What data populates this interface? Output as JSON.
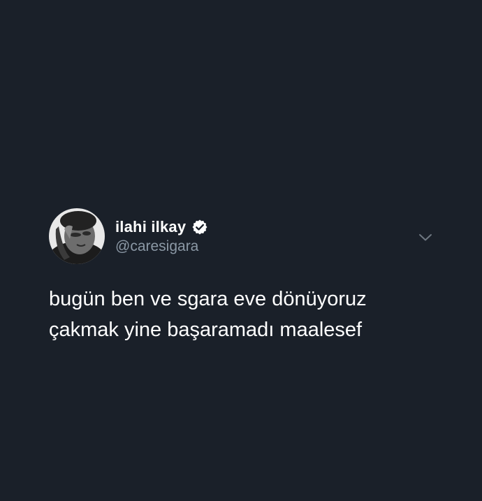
{
  "tweet": {
    "author": {
      "display_name": "ilahi ilkay",
      "handle": "@caresigara",
      "verified": true,
      "avatar_icon": "profile-photo"
    },
    "text_lines": [
      "bugün ben ve sgara eve dönüyoruz",
      "çakmak yine başaramadı maalesef"
    ],
    "menu_icon": "chevron-down-icon"
  },
  "colors": {
    "background": "#1a2029",
    "primary_text": "#ffffff",
    "secondary_text": "#8b98a5",
    "chevron": "#6e7781"
  }
}
